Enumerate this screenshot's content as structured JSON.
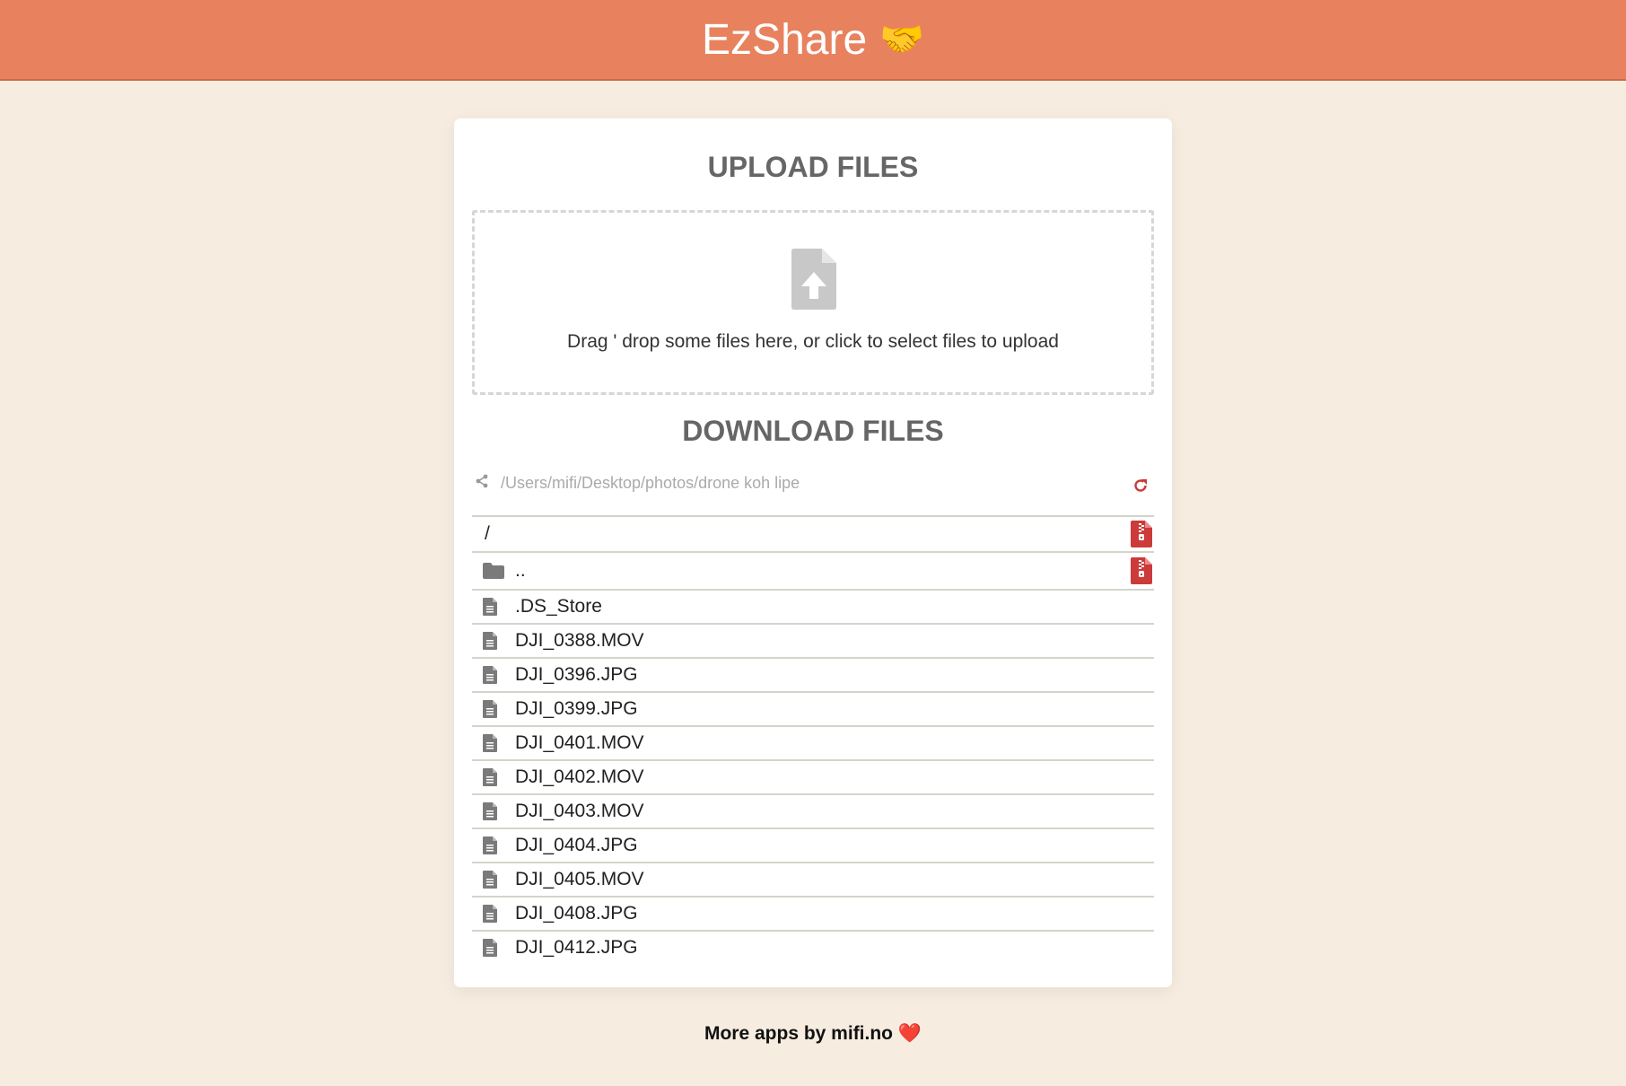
{
  "header": {
    "title": "EzShare",
    "emoji": "🤝"
  },
  "upload": {
    "title": "UPLOAD FILES",
    "dropzone_text": "Drag ' drop some files here, or click to select files to upload",
    "icon": "file-upload-icon"
  },
  "download": {
    "title": "DOWNLOAD FILES",
    "path": "/Users/mifi/Desktop/photos/drone koh lipe",
    "root_label": "/",
    "parent_label": "..",
    "files": [
      ".DS_Store",
      "DJI_0388.MOV",
      "DJI_0396.JPG",
      "DJI_0399.JPG",
      "DJI_0401.MOV",
      "DJI_0402.MOV",
      "DJI_0403.MOV",
      "DJI_0404.JPG",
      "DJI_0405.MOV",
      "DJI_0408.JPG",
      "DJI_0412.JPG"
    ]
  },
  "footer": {
    "text": "More apps by mifi.no",
    "emoji": "❤️"
  },
  "colors": {
    "header_bg": "#e8825e",
    "page_bg": "#f6ede0",
    "accent_red": "#cc3a3a",
    "icon_gray": "#7a7a7a"
  }
}
